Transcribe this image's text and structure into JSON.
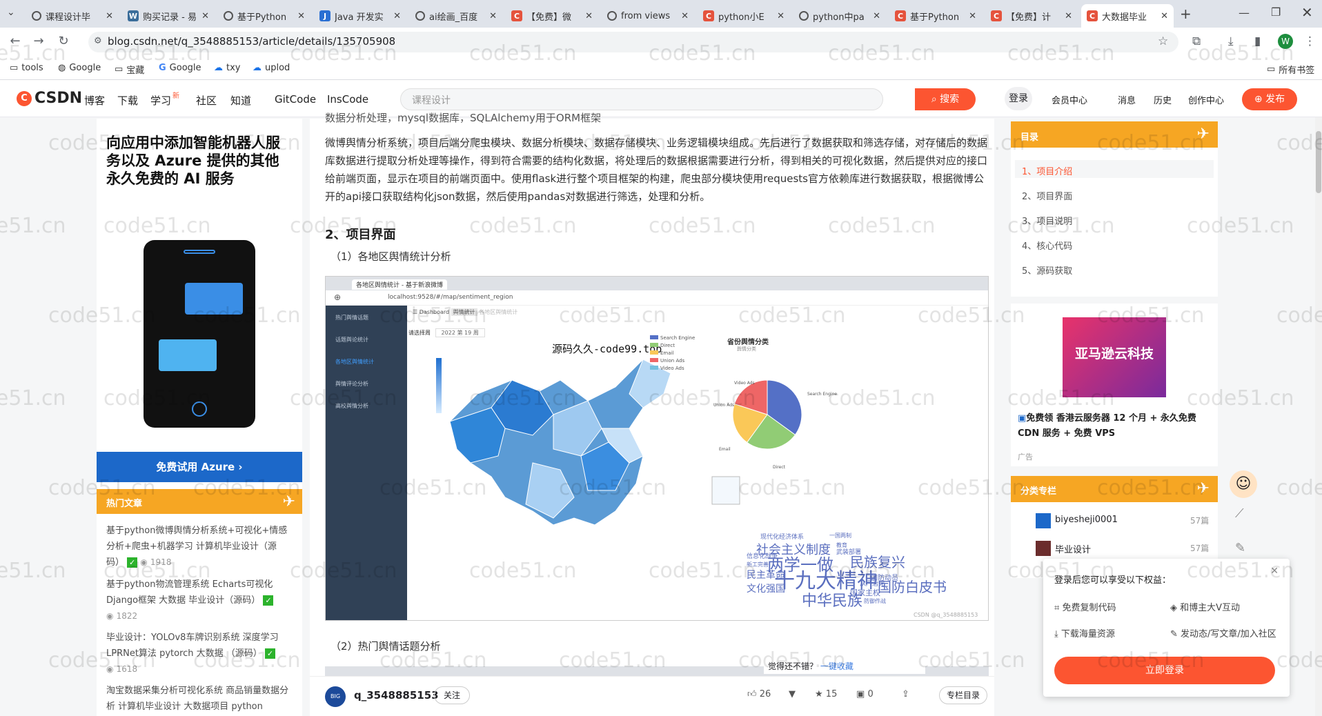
{
  "browser": {
    "tabs": [
      {
        "title": "课程设计毕",
        "icon": "globe-icon",
        "fav": "globe"
      },
      {
        "title": "购买记录 - 易",
        "icon": "wp-icon",
        "fav": "wp"
      },
      {
        "title": "基于Python",
        "icon": "gear-icon",
        "fav": "globe"
      },
      {
        "title": "Java 开发实",
        "icon": "jd-icon",
        "fav": "jd"
      },
      {
        "title": "ai绘画_百度",
        "icon": "gear-icon",
        "fav": "globe"
      },
      {
        "title": "【免费】微",
        "icon": "csdn-icon",
        "fav": "cs"
      },
      {
        "title": "from views",
        "icon": "gear-icon",
        "fav": "globe"
      },
      {
        "title": "python小E",
        "icon": "csdn-icon",
        "fav": "cs"
      },
      {
        "title": "python中pa",
        "icon": "globe-icon",
        "fav": "globe"
      },
      {
        "title": "基于Python",
        "icon": "csdn-icon",
        "fav": "cs"
      },
      {
        "title": "【免费】计",
        "icon": "csdn-icon",
        "fav": "cs"
      },
      {
        "title": "大数据毕业",
        "icon": "csdn-icon",
        "fav": "cs",
        "active": true
      }
    ],
    "url": "blog.csdn.net/q_3548885153/article/details/135705908",
    "bookmarks": [
      "tools",
      "Google",
      "宝藏",
      "Google",
      "txy",
      "uplod"
    ],
    "all_bookmarks": "所有书签"
  },
  "csdn": {
    "logo": "CSDN",
    "nav": [
      "博客",
      "下载",
      "学习",
      "社区",
      "知道",
      "GitCode",
      "InsCode"
    ],
    "search_placeholder": "课程设计",
    "search_btn": "搜索",
    "login": "登录",
    "right_nav": [
      "会员中心",
      "消息",
      "历史",
      "创作中心"
    ],
    "publish": "发布"
  },
  "left": {
    "ad_title": "向应用中添加智能机器人服务以及 Azure 提供的其他永久免费的 AI 服务",
    "ad_button": "免费试用 Azure",
    "hot_title": "热门文章",
    "hot": [
      {
        "title": "基于python微博舆情分析系统+可视化+情感分析+爬虫+机器学习 计算机毕业设计（源码）",
        "views": "1918"
      },
      {
        "title": "基于python物流管理系统 Echarts可视化 Django框架 大数据 毕业设计（源码）",
        "views": "1822"
      },
      {
        "title": "毕业设计：YOLOv8车牌识别系统 深度学习 LPRNet算法 pytorch 大数据 （源码）",
        "views": "1618"
      },
      {
        "title": "淘宝数据采集分析可视化系统 商品销量数据分析 计算机毕业设计 大数据项目 python",
        "views": ""
      }
    ]
  },
  "article": {
    "top_line": "数据分析处理，mysql数据库，SQLAlchemy用于ORM框架",
    "para": "微博舆情分析系统，项目后端分爬虫模块、数据分析模块、数据存储模块、业务逻辑模块组成。先后进行了数据获取和筛选存储，对存储后的数据库数据进行提取分析处理等操作，得到符合需要的结构化数据，将处理后的数据根据需要进行分析，得到相关的可视化数据，然后提供对应的接口给前端页面，显示在项目的前端页面中。使用flask进行整个项目框架的构建，爬虫部分模块使用requests官方依赖库进行数据获取，根据微博公开的api接口获取结构化json数据，然后使用pandas对数据进行筛选，处理和分析。",
    "h2": "2、项目界面",
    "sub1": "（1）各地区舆情统计分析",
    "sub2": "（2）热门舆情话题分析",
    "shot": {
      "tab": "各地区舆情统计 - 基于新浪微博",
      "url": "localhost:9528/#/map/sentiment_region",
      "side": [
        "热门舆情话题",
        "话题舆论统计",
        "各地区舆情统计",
        "舆情评论分析",
        "高校舆情分析"
      ],
      "crumb": [
        "Dashboard",
        "舆情统计",
        "各地区舆情统计"
      ],
      "filter": "请选择周",
      "week": "2022 第 19 周",
      "watermark": "源码久久-code99.top",
      "pie_title": "省份舆情分类",
      "pie_sub": "舆情分类",
      "legend": [
        "Search Engine",
        "Direct",
        "Email",
        "Union Ads",
        "Video Ads"
      ],
      "legend_colors": [
        "#5470c6",
        "#91cc75",
        "#fac858",
        "#ee6666",
        "#73c0de"
      ],
      "pie_values": [
        35,
        25,
        20,
        20
      ],
      "pie_labels": [
        "Search Engine",
        "Direct",
        "Email",
        "Union Ads",
        "Video Ads"
      ],
      "words": [
        "现代化经济体系",
        "一国两制",
        "社会主义制度",
        "教育",
        "民族复兴",
        "信息化战争",
        "武装部署",
        "两学一做",
        "新工完善",
        "民主革命",
        "十九大精神",
        "文化强国",
        "国防白皮书",
        "中华民族",
        "国家主权",
        "防御作战",
        "国防动员",
        "从严治党"
      ],
      "csdn_mark": "CSDN @q_3548885153"
    },
    "feedback": "觉得还不错？",
    "collect": "一键收藏",
    "author": "q_3548885153",
    "follow": "关注",
    "likes": "26",
    "stars": "15",
    "comments": "0",
    "column_list": "专栏目录"
  },
  "right": {
    "toc_title": "目录",
    "toc": [
      "1、项目介绍",
      "2、项目界面",
      "3、项目说明",
      "4、核心代码",
      "5、源码获取"
    ],
    "ad_banner": "亚马逊云科技",
    "ad_text": "免费领 香港云服务器 12 个月 + 永久免费 CDN 服务 + 免费 VPS",
    "ad_tag": "广告",
    "column_title": "分类专栏",
    "columns": [
      {
        "name": "biyesheji0001",
        "count": "57篇"
      },
      {
        "name": "毕业设计",
        "count": "57篇"
      }
    ],
    "login_title": "登录后您可以享受以下权益：",
    "login_items": [
      "免费复制代码",
      "和博主大V互动",
      "下载海量资源",
      "发动态/写文章/加入社区"
    ],
    "login_button": "立即登录"
  },
  "watermark": "code51.cn"
}
